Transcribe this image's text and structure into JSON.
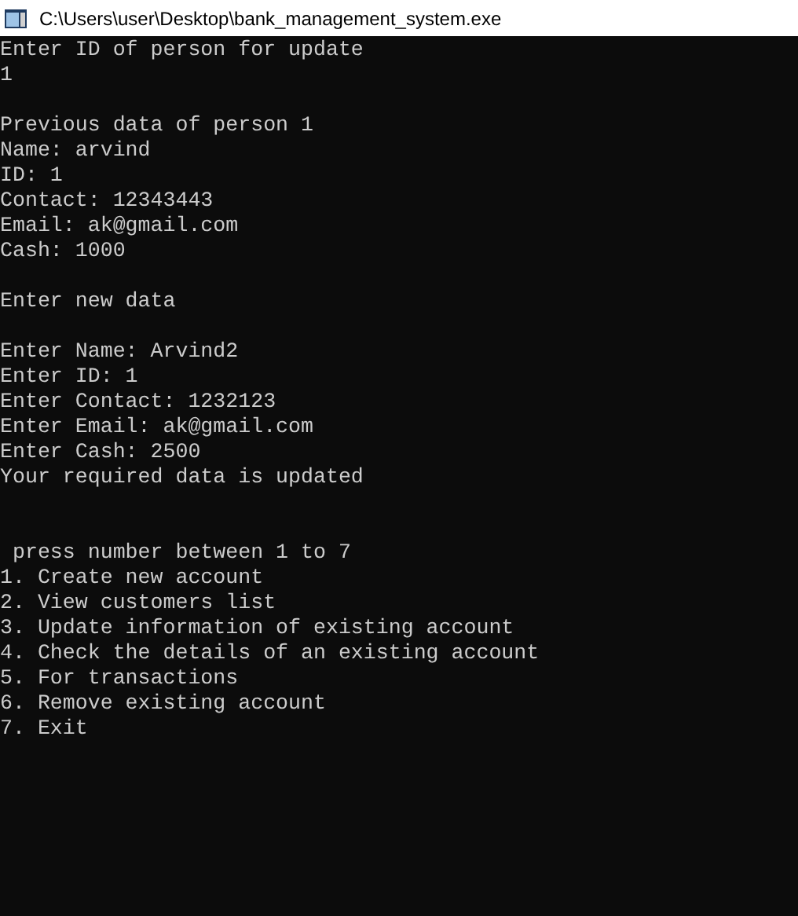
{
  "window": {
    "title": "C:\\Users\\user\\Desktop\\bank_management_system.exe"
  },
  "console": {
    "lines": [
      {
        "kind": "text",
        "text": "Enter ID of person for update"
      },
      {
        "kind": "text",
        "text": "1"
      },
      {
        "kind": "blank"
      },
      {
        "kind": "text",
        "text": "Previous data of person 1"
      },
      {
        "kind": "text",
        "text": "Name: arvind"
      },
      {
        "kind": "text",
        "text": "ID: 1"
      },
      {
        "kind": "text",
        "text": "Contact: 12343443"
      },
      {
        "kind": "text",
        "text": "Email: ak@gmail.com"
      },
      {
        "kind": "text",
        "text": "Cash: 1000"
      },
      {
        "kind": "blank"
      },
      {
        "kind": "text",
        "text": "Enter new data"
      },
      {
        "kind": "blank"
      },
      {
        "kind": "text",
        "text": "Enter Name: Arvind2"
      },
      {
        "kind": "text",
        "text": "Enter ID: 1"
      },
      {
        "kind": "text",
        "text": "Enter Contact: 1232123"
      },
      {
        "kind": "text",
        "text": "Enter Email: ak@gmail.com"
      },
      {
        "kind": "text",
        "text": "Enter Cash: 2500"
      },
      {
        "kind": "text",
        "text": "Your required data is updated"
      },
      {
        "kind": "blank"
      },
      {
        "kind": "blank"
      },
      {
        "kind": "text",
        "text": " press number between 1 to 7"
      },
      {
        "kind": "text",
        "text": "1. Create new account"
      },
      {
        "kind": "text",
        "text": "2. View customers list"
      },
      {
        "kind": "text",
        "text": "3. Update information of existing account"
      },
      {
        "kind": "text",
        "text": "4. Check the details of an existing account"
      },
      {
        "kind": "text",
        "text": "5. For transactions"
      },
      {
        "kind": "text",
        "text": "6. Remove existing account"
      },
      {
        "kind": "text",
        "text": "7. Exit"
      }
    ]
  }
}
